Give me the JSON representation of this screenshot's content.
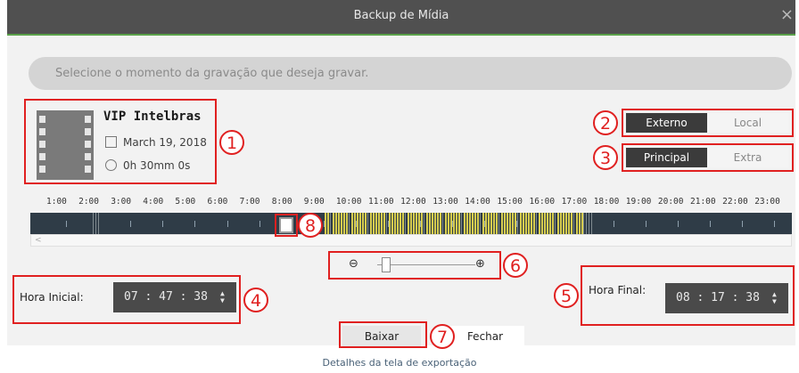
{
  "window": {
    "title": "Backup de Mídia",
    "close_glyph": "×"
  },
  "prompt": "Selecione o momento da gravação que deseja gravar.",
  "camera": {
    "name": "VIP Intelbras",
    "date": "March 19, 2018",
    "duration": "0h 30mm 0s"
  },
  "storage_toggle": {
    "options": [
      "Externo",
      "Local"
    ],
    "selected": "Externo"
  },
  "stream_toggle": {
    "options": [
      "Principal",
      "Extra"
    ],
    "selected": "Principal"
  },
  "timeline": {
    "hours": [
      "1:00",
      "2:00",
      "3:00",
      "4:00",
      "5:00",
      "6:00",
      "7:00",
      "8:00",
      "9:00",
      "10:00",
      "11:00",
      "12:00",
      "13:00",
      "14:00",
      "15:00",
      "16:00",
      "17:00",
      "18:00",
      "19:00",
      "20:00",
      "21:00",
      "22:00",
      "23:00"
    ],
    "scroll_glyph": "<"
  },
  "zoom": {
    "out_icon": "zoom-out-icon",
    "in_icon": "zoom-in-icon",
    "level": 0.05
  },
  "start": {
    "label": "Hora Inicial:",
    "value": "07 : 47 : 38"
  },
  "end": {
    "label": "Hora Final:",
    "value": "08 : 17 : 38"
  },
  "buttons": {
    "download": "Baixar",
    "close": "Fechar"
  },
  "callouts": [
    "1",
    "2",
    "3",
    "4",
    "5",
    "6",
    "7",
    "8"
  ],
  "caption": "Detalhes da tela de exportação",
  "colors": {
    "titlebar": "#505050",
    "accent_line": "#5aa04a",
    "callout": "#e02020",
    "timeline": "#2f3c47",
    "recording": "#d6cc4e"
  }
}
